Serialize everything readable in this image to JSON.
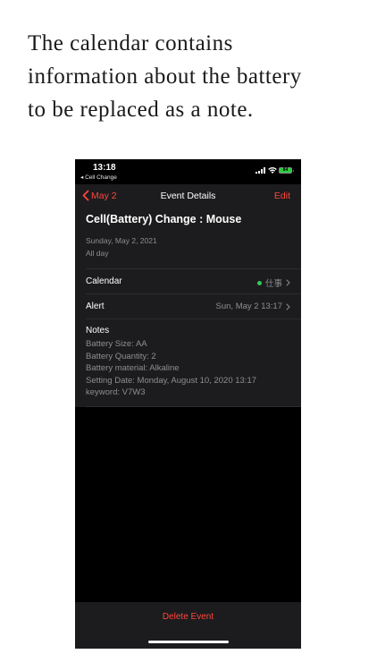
{
  "caption": {
    "lines": [
      "The calendar contains",
      "information about the battery",
      "to be replaced as a note."
    ]
  },
  "status_bar": {
    "time": "13:18",
    "back_app": "◂ Cell Change",
    "battery_text": "84"
  },
  "nav": {
    "back_label": "May 2",
    "title": "Event Details",
    "edit_label": "Edit"
  },
  "event": {
    "title": "Cell(Battery) Change : Mouse",
    "date": "Sunday, May 2, 2021",
    "all_day": "All day"
  },
  "rows": {
    "calendar": {
      "label": "Calendar",
      "value": "仕事",
      "dot_color": "#34c759"
    },
    "alert": {
      "label": "Alert",
      "value": "Sun, May 2 13:17"
    }
  },
  "notes": {
    "label": "Notes",
    "lines": [
      "Battery Size: AA",
      "Battery Quantity: 2",
      "Battery material: Alkaline",
      "Setting Date: Monday, August 10, 2020 13:17",
      "keyword: V7W3"
    ]
  },
  "footer": {
    "delete_label": "Delete Event"
  },
  "colors": {
    "accent": "#ff453a",
    "background": "#000000",
    "surface": "#1c1c1e",
    "secondary_text": "#8e8e93"
  }
}
